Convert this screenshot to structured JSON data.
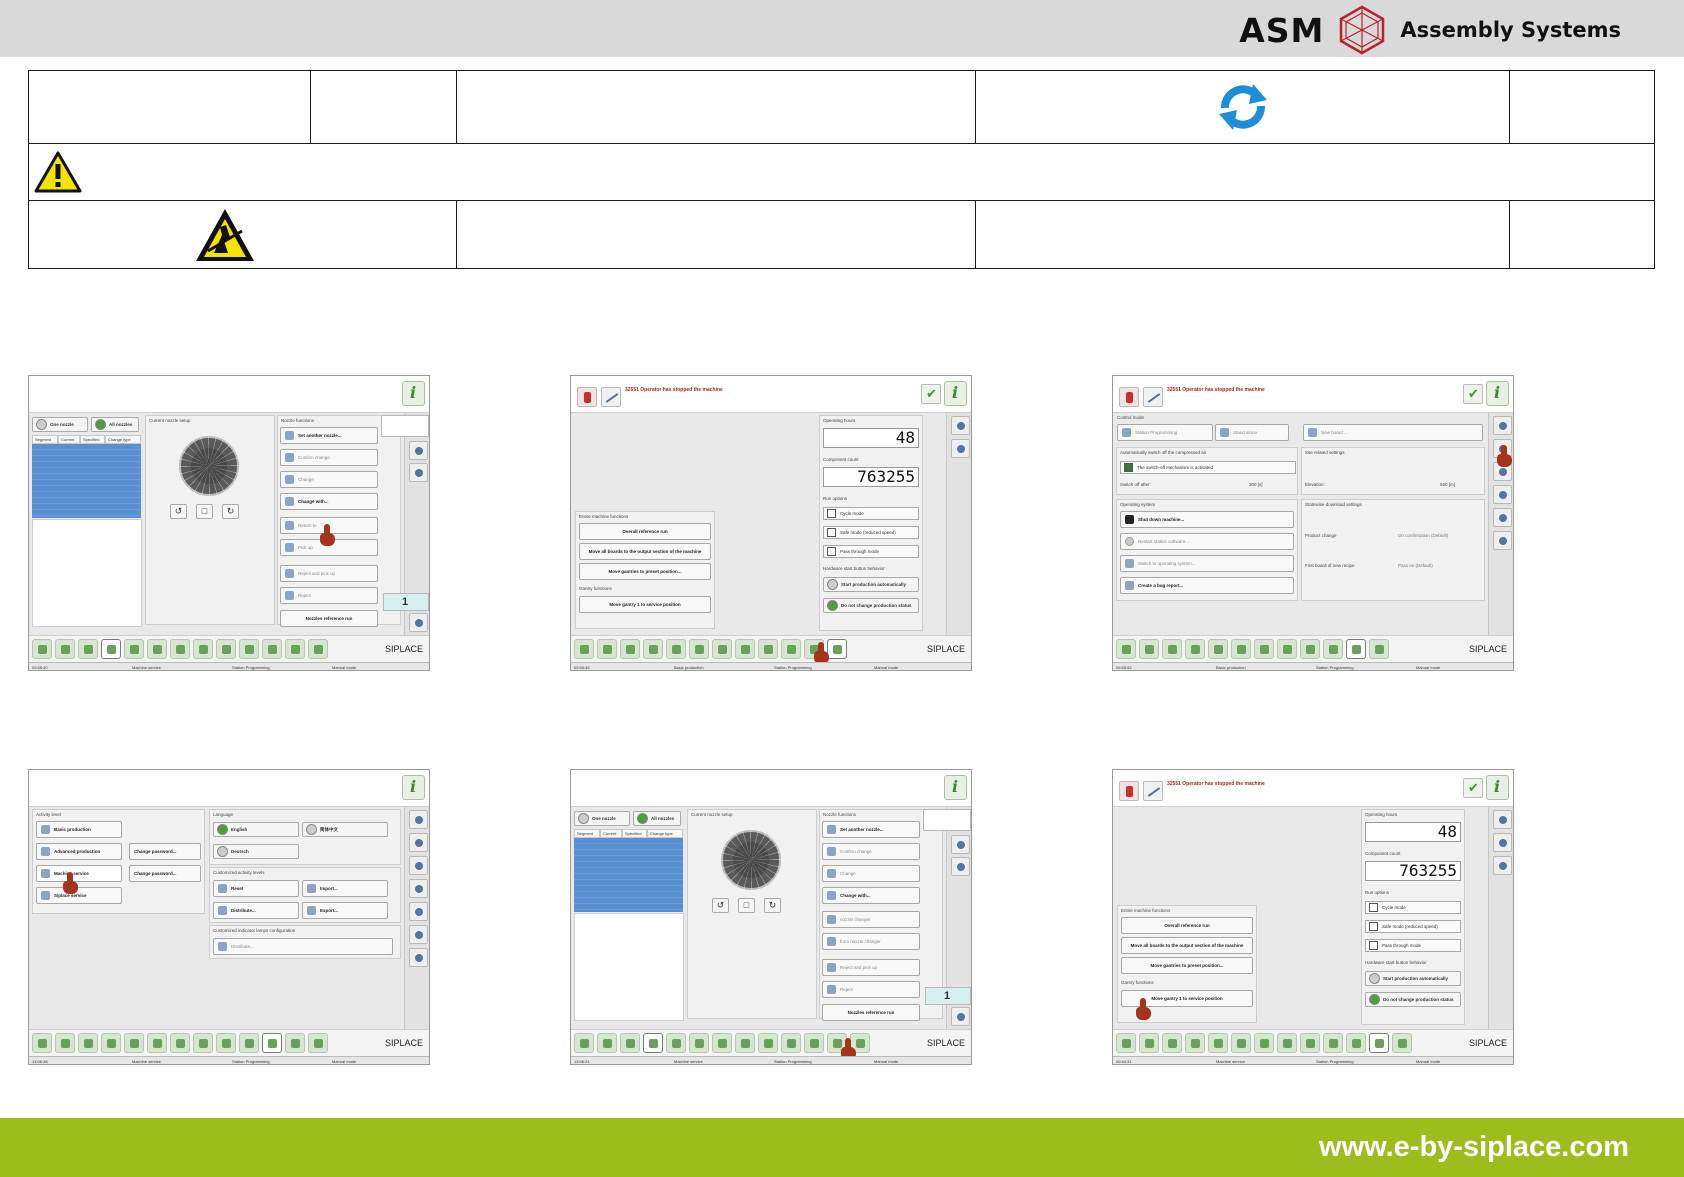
{
  "header": {
    "brand_name": "ASM",
    "brand_tagline": "Assembly Systems",
    "logo": "asm-hexagon-logo",
    "bar_color": "#d9d9d9"
  },
  "info_table": {
    "refresh_icon": "refresh-icon",
    "warning_icon": "warning-triangle-icon",
    "esd_icon": "esd-warning-icon"
  },
  "common": {
    "siplace": "SIPLACE",
    "machine_service": "Machine service",
    "basic_production": "Basic production",
    "station_programming": "Station Programming",
    "manual_mode": "Manual mode"
  },
  "nozzle_screen": {
    "one_nozzle": "One nozzle",
    "all_nozzles": "All nozzles",
    "columns": [
      "Segment",
      "Current",
      "Specified",
      "Change type"
    ],
    "current_nozzle_setup": "Current nozzle setup",
    "nozzle_functions": "Nozzle functions",
    "functions": [
      "Set another nozzle...",
      "Confirm change",
      "Change",
      "Change with..."
    ],
    "return_to": "Return to",
    "nozzle_changer": "nozzle changer",
    "pick_up": "Pick up",
    "from_nozzle_changer": "from nozzle changer",
    "reject_and_pick_up_1": "Reject and pick up",
    "reject_and_pick_up_2": "Reject and pick up",
    "reject": "Reject",
    "nozzles_reference_run": "Nozzles reference run",
    "counter": "1",
    "time_1": "09:55:40",
    "time_2": "13:06:21"
  },
  "production_screen": {
    "message": "32551 Operator has stopped the machine",
    "operating_hours": "Operating hours",
    "operating_hours_value": "48",
    "component_count": "Component count",
    "component_count_value": "763255",
    "run_options": "Run options",
    "cycle_mode": "Cycle mode",
    "safe_mode": "Safe mode (reduced speed)",
    "pass_through": "Pass through mode",
    "hw_start_behavior": "Hardware start button behavior",
    "start_auto": "Start production automatically",
    "no_change": "Do not change production status",
    "entire_machine_functions": "Entire machine functions",
    "overall_reference_run": "Overall reference run",
    "move_all_boards": "Move all boards to the output section of the machine",
    "move_gantries": "Move gantries to preset position...",
    "gantry_functions": "Gantry functions",
    "move_gantry_1": "Move gantry 1 to service position",
    "time_1": "09:55:45",
    "time_2": "09:44:31"
  },
  "control_screen": {
    "message": "32551 Operator has stopped the machine",
    "control_mode": "Control mode",
    "station_programming": "Station Programming",
    "stand_alone": "Stand alone",
    "new_board": "New board ...",
    "auto_switch_off": "Automatically switch off the compressed air",
    "switch_off_active": "The switch-off mechanism is activated",
    "switch_off_after": "Switch off after:",
    "switch_off_value": "300 [s]",
    "site_settings": "Site related settings",
    "elevation": "Elevation:",
    "elevation_value": "550 [m]",
    "operating_system": "Operating system",
    "shut_down": "Shut down machine...",
    "restart_software": "Restart station software...",
    "switch_os": "Switch to operating system...",
    "bug_report": "Create a bug report...",
    "statewise_download": "Statewise download settings",
    "product_change": "Product change",
    "product_change_value": "On confirmation (Default)",
    "first_board": "First board of new recipe",
    "first_board_value": "Pass on (Default)",
    "time": "09:55:52"
  },
  "activity_screen": {
    "activity_level": "Activity level",
    "levels": [
      "Basic production",
      "Advanced production",
      "Machine service",
      "Siplace service"
    ],
    "change_password": "Change password...",
    "language": "Language",
    "english": "English",
    "chinese": "简体中文",
    "deutsch": "Deutsch",
    "custom_levels": "Customized activity levels",
    "reset": "Reset",
    "import": "Import...",
    "distribute": "Distribute...",
    "export": "Export...",
    "indicator_config": "Customized indicator lamps configuration",
    "time": "13:06:38"
  },
  "footer": {
    "url": "www.e-by-siplace.com",
    "color": "#9dbd1d"
  }
}
